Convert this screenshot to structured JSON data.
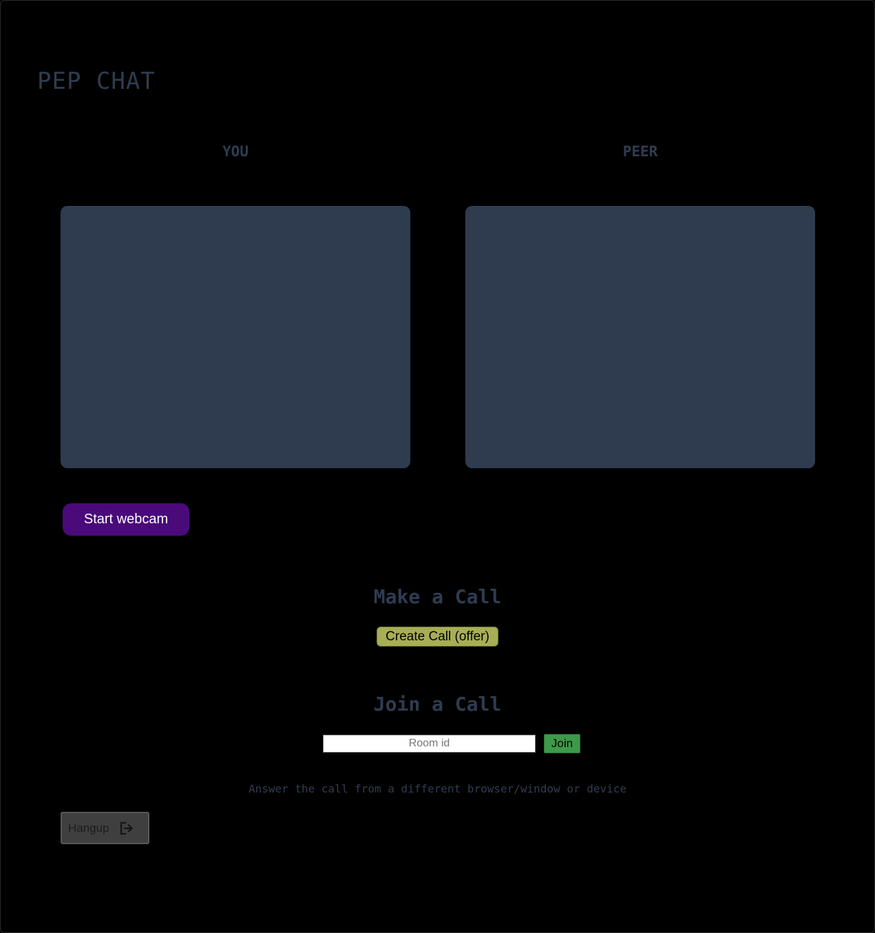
{
  "app": {
    "title": "PEP CHAT"
  },
  "videos": {
    "local_label": "YOU",
    "remote_label": "PEER"
  },
  "controls": {
    "start_webcam_label": "Start webcam",
    "make_call_heading": "Make a Call",
    "create_call_label": "Create Call (offer)",
    "join_call_heading": "Join a Call",
    "room_id_placeholder": "Room id",
    "room_id_value": "",
    "join_label": "Join",
    "hint": "Answer the call from a different browser/window or device",
    "hangup_label": "Hangup"
  },
  "icons": {
    "hangup": "logout-icon"
  },
  "colors": {
    "background": "#000000",
    "text_muted": "#2f3c50",
    "video_placeholder": "#2f3c50",
    "webcam_button": "#4a0a7a",
    "create_call_button": "#a8ae55",
    "join_button": "#3d9a4a",
    "hangup_button": "#3f3f3f"
  }
}
